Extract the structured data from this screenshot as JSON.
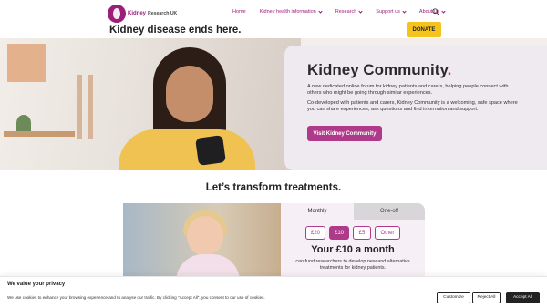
{
  "header": {
    "logo_word": "Kidney",
    "logo_sub": "Research UK",
    "tagline": "Kidney disease ends here.",
    "nav": [
      {
        "label": "Home",
        "chevron": false
      },
      {
        "label": "Kidney health information",
        "chevron": true
      },
      {
        "label": "Research",
        "chevron": true
      },
      {
        "label": "Support us",
        "chevron": true
      },
      {
        "label": "About us",
        "chevron": true
      }
    ],
    "donate_label": "DONATE",
    "colors": {
      "brand": "#9b1f7a",
      "donate": "#f5c41c"
    }
  },
  "hero": {
    "title": "Kidney Community",
    "title_dot": ".",
    "paragraph1": "A new dedicated online forum for kidney patients and carers, helping people connect with others who might be going through similar experiences.",
    "paragraph2": "Co-developed with patients and carers, Kidney Community is a welcoming, safe space where you can share experiences, ask questions and find information and support.",
    "button_label": "Visit Kidney Community"
  },
  "section": {
    "title": "Let’s transform treatments.",
    "tabs": [
      "Monthly",
      "One-off"
    ],
    "amounts": [
      "£20",
      "£10",
      "£5",
      "Other"
    ],
    "selected_amount": "£10",
    "headline": "Your £10 a month",
    "description": "can fund researchers to develop new and alternative treatments for kidney patients."
  },
  "cookie": {
    "title": "We value your privacy",
    "text": "We use cookies to enhance your browsing experience and to analyse our traffic. By clicking \"Accept All\", you consent to our use of cookies.",
    "buttons": {
      "customize": "Customize",
      "reject": "Reject All",
      "accept": "Accept All"
    }
  }
}
